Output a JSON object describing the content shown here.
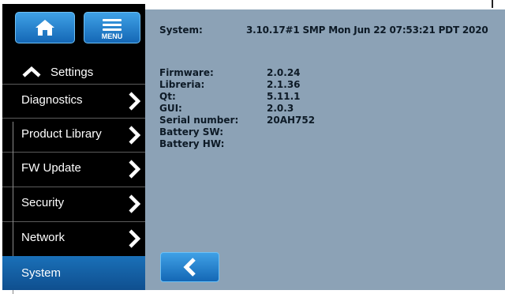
{
  "sidebar": {
    "menu_label": "MENU",
    "settings_label": "Settings",
    "items": [
      {
        "label": "Diagnostics"
      },
      {
        "label": "Product Library"
      },
      {
        "label": "FW Update"
      },
      {
        "label": "Security"
      },
      {
        "label": "Network"
      }
    ],
    "active_item": {
      "label": "System"
    }
  },
  "main": {
    "system_label": "System:",
    "system_value": "3.10.17#1 SMP Mon Jun 22 07:53:21 PDT 2020",
    "info": [
      {
        "key": "Firmware:",
        "value": "2.0.24"
      },
      {
        "key": "Libreria:",
        "value": "2.1.36"
      },
      {
        "key": "Qt:",
        "value": "5.11.1"
      },
      {
        "key": "GUI:",
        "value": "2.0.3"
      },
      {
        "key": "Serial number:",
        "value": "20AH752"
      },
      {
        "key": "Battery SW:",
        "value": ""
      },
      {
        "key": "Battery HW:",
        "value": ""
      }
    ]
  },
  "colors": {
    "sidebar_bg": "#000000",
    "main_bg": "#8ca2b6",
    "button_blue": "#1e7ccb",
    "active_item_blue": "#1464a8"
  },
  "icons": {
    "home": "home-icon",
    "menu": "hamburger-icon",
    "settings_up": "chevron-up-icon",
    "item_arrow": "chevron-right-icon",
    "back": "chevron-left-icon"
  }
}
